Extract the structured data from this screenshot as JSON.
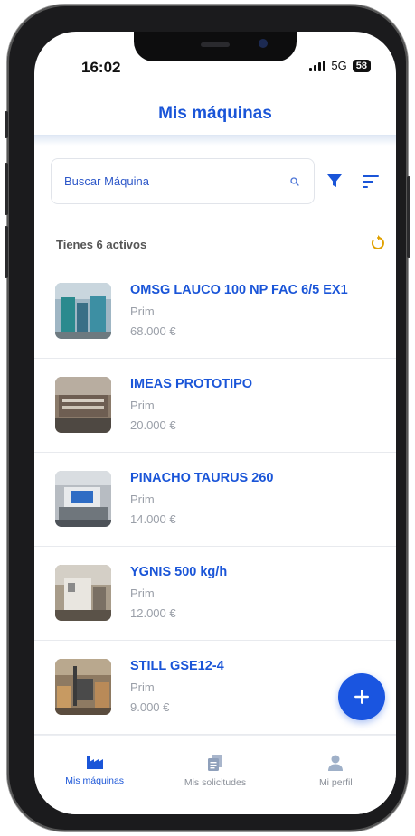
{
  "status_bar": {
    "time": "16:02",
    "network": "5G",
    "battery": "58"
  },
  "header": {
    "title": "Mis máquinas"
  },
  "search": {
    "placeholder": "Buscar Máquina"
  },
  "summary": {
    "count_label": "Tienes 6 activos"
  },
  "machines": [
    {
      "title": "OMSG LAUCO 100 NP FAC 6/5 EX1",
      "subtitle": "Prim",
      "price": "68.000 €"
    },
    {
      "title": "IMEAS PROTOTIPO",
      "subtitle": "Prim",
      "price": "20.000 €"
    },
    {
      "title": "PINACHO TAURUS 260",
      "subtitle": "Prim",
      "price": "14.000 €"
    },
    {
      "title": "YGNIS 500 kg/h",
      "subtitle": "Prim",
      "price": "12.000 €"
    },
    {
      "title": "STILL GSE12-4",
      "subtitle": "Prim",
      "price": "9.000 €"
    }
  ],
  "bottom_nav": [
    {
      "label": "Mis máquinas",
      "icon": "factory-icon",
      "active": true
    },
    {
      "label": "Mis solicitudes",
      "icon": "documents-icon",
      "active": false
    },
    {
      "label": "Mi perfil",
      "icon": "user-icon",
      "active": false
    }
  ],
  "colors": {
    "accent": "#1a55d8",
    "refresh": "#e0a100",
    "muted": "#9a9fa8"
  },
  "icons": {
    "search": "search-icon",
    "filter": "filter-icon",
    "sort": "sort-icon",
    "refresh": "refresh-icon",
    "add": "plus-icon"
  }
}
